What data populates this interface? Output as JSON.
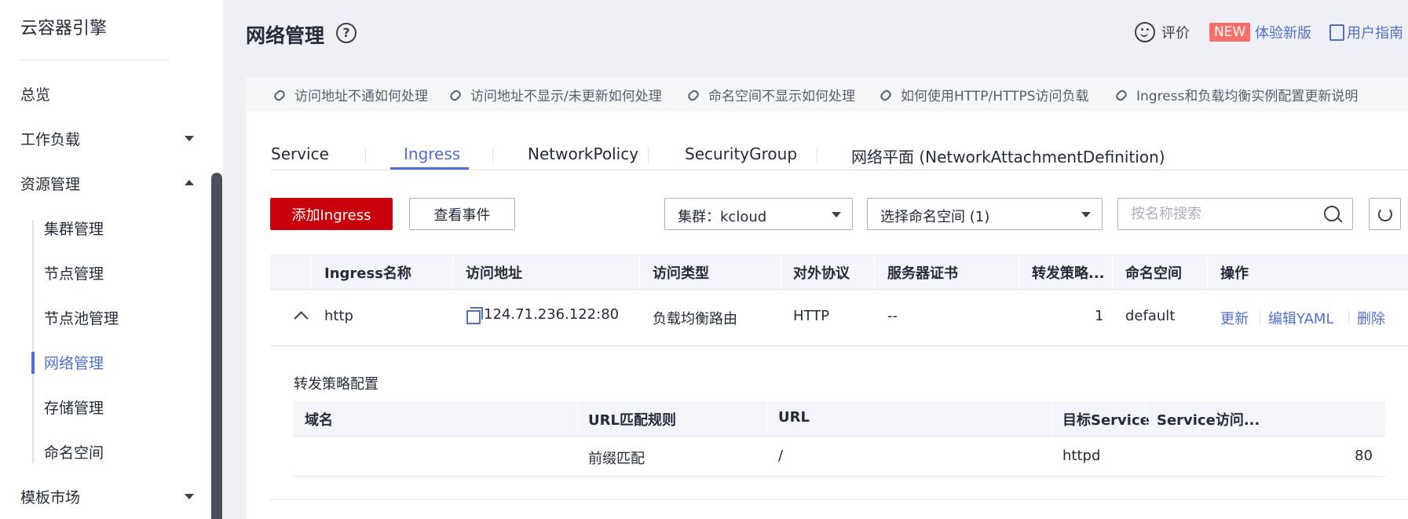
{
  "sidebar": {
    "brand": "云容器引擎",
    "items": [
      {
        "label": "总览"
      },
      {
        "label": "工作负载"
      },
      {
        "label": "资源管理"
      },
      {
        "label": "模板市场"
      }
    ],
    "sub_items": [
      {
        "label": "集群管理"
      },
      {
        "label": "节点管理"
      },
      {
        "label": "节点池管理"
      },
      {
        "label": "网络管理"
      },
      {
        "label": "存储管理"
      },
      {
        "label": "命名空间"
      }
    ],
    "active_sub_item": "网络管理"
  },
  "header": {
    "title": "网络管理",
    "help_glyph": "?",
    "feedback": "评价",
    "new_badge": "NEW",
    "try_new": "体验新版",
    "guide": "用户指南"
  },
  "quick_links": [
    "访问地址不通如何处理",
    "访问地址不显示/未更新如何处理",
    "命名空间不显示如何处理",
    "如何使用HTTP/HTTPS访问负载",
    "Ingress和负载均衡实例配置更新说明"
  ],
  "tabs": [
    {
      "label": "Service"
    },
    {
      "label": "Ingress"
    },
    {
      "label": "NetworkPolicy"
    },
    {
      "label": "SecurityGroup"
    },
    {
      "label": "网络平面 (NetworkAttachmentDefinition)"
    }
  ],
  "active_tab": "Ingress",
  "toolbar": {
    "add_button": "添加Ingress",
    "events_button": "查看事件",
    "cluster_select": "集群：kcloud",
    "namespace_select": "选择命名空间 (1)",
    "search_placeholder": "按名称搜索"
  },
  "table": {
    "columns": [
      "Ingress名称",
      "访问地址",
      "访问类型",
      "对外协议",
      "服务器证书",
      "转发策略...",
      "命名空间",
      "操作"
    ],
    "rows": [
      {
        "name": "http",
        "address": "124.71.236.122:80",
        "type": "负载均衡路由",
        "protocol": "HTTP",
        "certificate": "--",
        "rules": "1",
        "namespace": "default",
        "actions": [
          "更新",
          "编辑YAML",
          "删除"
        ]
      }
    ]
  },
  "expanded": {
    "title": "转发策略配置",
    "columns": [
      "域名",
      "URL匹配规则",
      "URL",
      "目标Service",
      "Service访问..."
    ],
    "rows": [
      {
        "domain": "",
        "match": "前缀匹配",
        "url": "/",
        "service": "httpd",
        "port": "80"
      }
    ]
  },
  "colors": {
    "primary": "#c7000b",
    "link": "#526ecc",
    "new_badge": "#f66f6a"
  },
  "icons": [
    "help-icon",
    "smile-icon",
    "guide-icon",
    "link-icon",
    "search-icon",
    "refresh-icon",
    "copy-icon",
    "collapse-icon",
    "chevron-down-icon",
    "chevron-up-icon"
  ]
}
